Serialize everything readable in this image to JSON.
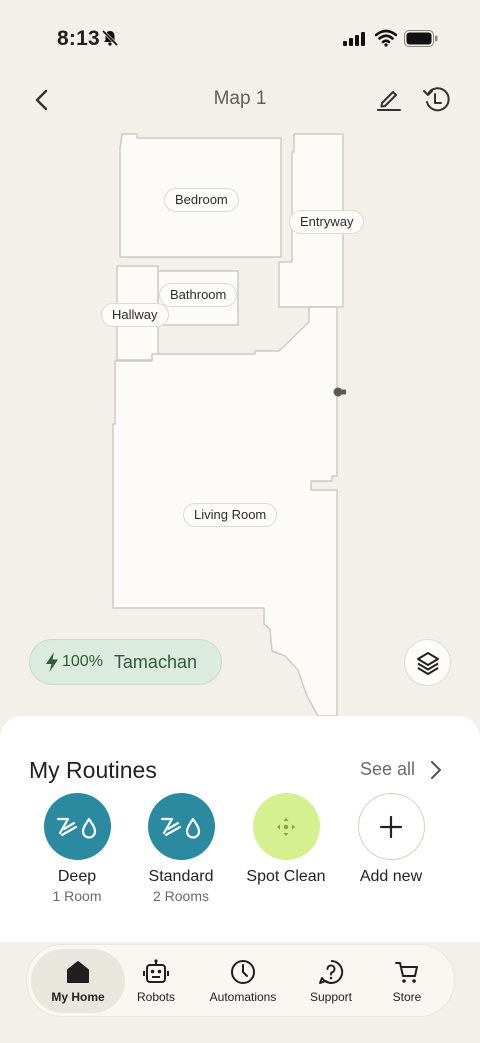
{
  "status_bar": {
    "time": "8:13"
  },
  "nav": {
    "title": "Map 1"
  },
  "map": {
    "rooms": [
      "Bedroom",
      "Entryway",
      "Bathroom",
      "Hallway",
      "Living Room"
    ]
  },
  "robot": {
    "battery": "100%",
    "name": "Tamachan"
  },
  "routines": {
    "title": "My Routines",
    "see_all": "See all",
    "items": [
      {
        "name": "Deep",
        "sub": "1 Room",
        "color": "#2b8aa0"
      },
      {
        "name": "Standard",
        "sub": "2 Rooms",
        "color": "#2b8aa0"
      },
      {
        "name": "Spot Clean",
        "sub": "",
        "color": "#d5f08f"
      },
      {
        "name": "Add new",
        "sub": ""
      }
    ]
  },
  "tabs": [
    {
      "label": "My Home",
      "icon": "home-icon",
      "active": true
    },
    {
      "label": "Robots",
      "icon": "robot-icon"
    },
    {
      "label": "Automations",
      "icon": "clock-icon"
    },
    {
      "label": "Support",
      "icon": "help-icon"
    },
    {
      "label": "Store",
      "icon": "cart-icon"
    }
  ],
  "colors": {
    "accent_green": "#2f5a3a",
    "routine_teal": "#2b8aa0",
    "spot_clean": "#d5f08f"
  }
}
